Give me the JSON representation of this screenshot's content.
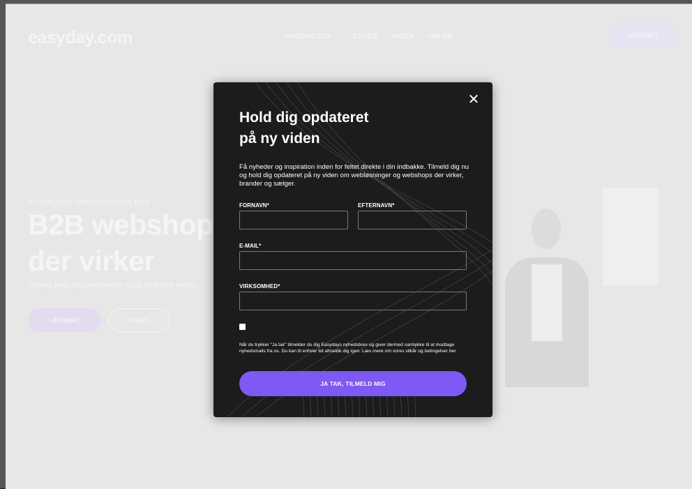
{
  "header": {
    "logo": "easyday.com",
    "nav": [
      {
        "label": "PRODUKTER ⌄"
      },
      {
        "label": "CASES"
      },
      {
        "label": "VIDEN"
      },
      {
        "label": "OM OS"
      }
    ],
    "contact_label": "KONTAKT"
  },
  "hero": {
    "eyebrow": "VI HJÆLPER VIRKSOMHEDER MED",
    "title_line1": "B2B webshops",
    "title_line2": "der virker",
    "subtitle": "Optimer jeres salgsmuligheder og nå ud til flere kunder",
    "read_more_label": "LÆS MERE",
    "cases_label": "CASES"
  },
  "modal": {
    "close_symbol": "✕",
    "title_line1": "Hold dig opdateret",
    "title_line2": "på ny viden",
    "description": "Få nyheder og inspiration inden for feltet direkte i din indbakke. Tilmeld dig nu og hold dig opdateret på ny viden om webløsninger og webshops der virker, brander og sælger.",
    "fields": {
      "firstname_label": "FORNAVN*",
      "lastname_label": "EFTERNAVN*",
      "email_label": "E-MAIL*",
      "company_label": "VIRKSOMHED*"
    },
    "consent_text": "Når du trykker \"Ja tak\" tilmelder du dig Easydays nyhedsbrev og giver dermed samtykke til at modtage nyhedsmails fra os. Du kan til enhver tid afmelde dig igen. Læs mere om vores vilkår og betingelser her.",
    "submit_label": "JA TAK, TILMELD MIG",
    "accent_color": "#7e59f5"
  }
}
